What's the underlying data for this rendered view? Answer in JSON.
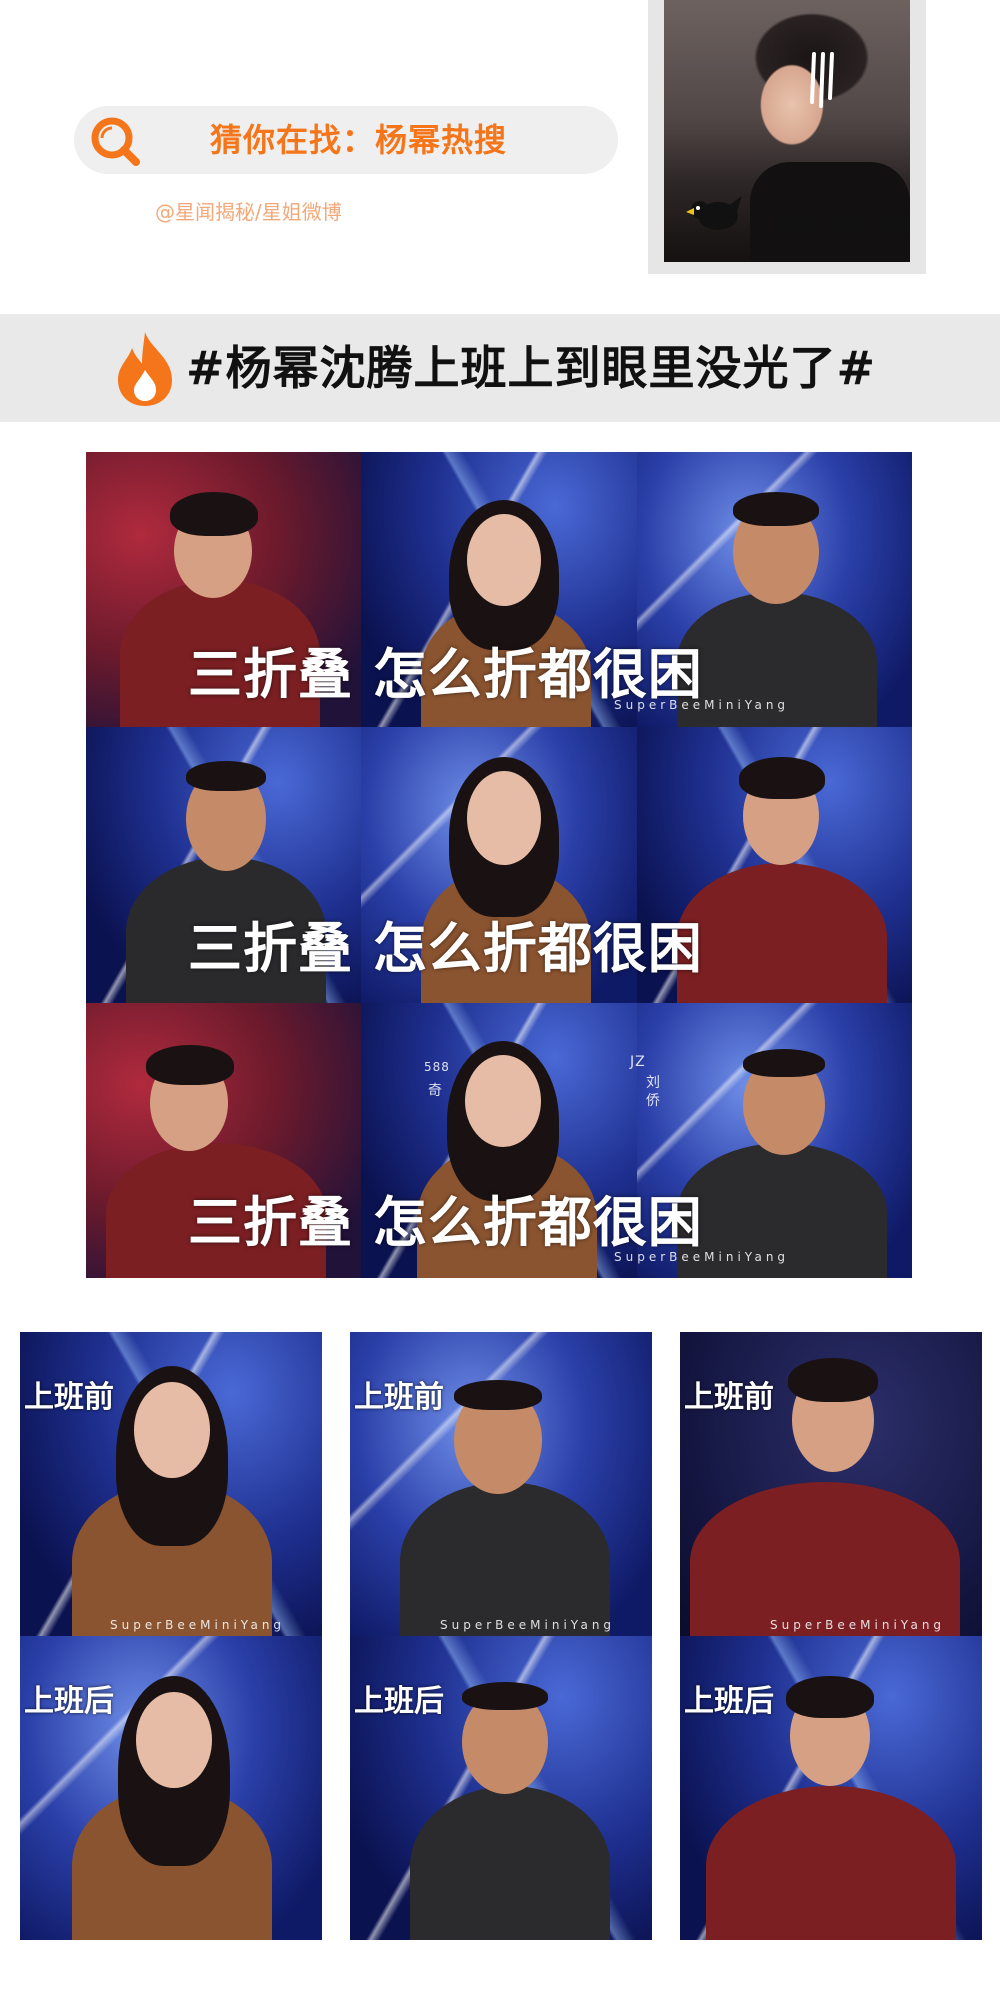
{
  "search": {
    "text": "猜你在找：杨幂热搜",
    "source": "@星闻揭秘/星姐微博"
  },
  "avatar": {
    "dots": "●●●●●●"
  },
  "hashtag": {
    "text": "#杨幂沈腾上班上到眼里没光了#"
  },
  "meme_grid": {
    "captions": [
      "三折叠 怎么折都很困",
      "三折叠 怎么折都很困",
      "三折叠 怎么折都很困"
    ],
    "watermark": "SuperBeeMiniYang",
    "stage_marks": [
      "JZ",
      "刘",
      "侨",
      "588",
      "奇"
    ]
  },
  "comparison": {
    "before_label": "上班前",
    "after_label": "上班后",
    "watermark": "SuperBeeMiniYang"
  },
  "colors": {
    "accent_orange": "#f5761a",
    "source_text": "#f3a879",
    "banner_bg": "#e9e9e9",
    "search_bg": "#efefef"
  }
}
